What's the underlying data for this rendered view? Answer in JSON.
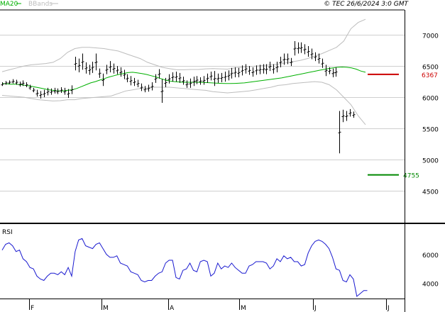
{
  "header": {
    "legend_ma": "MA20",
    "legend_bb": "BBands",
    "copyright": "© TEC 26/6/2024 3:0 GMT"
  },
  "colors": {
    "ma": "#00b000",
    "bands": "#bdbdbd",
    "price": "#000000",
    "rsi": "#1a1ad0",
    "resistance": "#cc0000",
    "support": "#008800",
    "grid": "#cfcfcf",
    "frame": "#000000"
  },
  "chart_data": [
    {
      "type": "ohlc",
      "title": "",
      "ylim": [
        4000,
        7400
      ],
      "y_ticks": [
        4500,
        5000,
        5500,
        6000,
        6500,
        7000
      ],
      "y_tick_labels": [
        "4500",
        "5000",
        "5500",
        "6000",
        "6500",
        "7000"
      ],
      "x_ticks": [
        "F",
        "M",
        "A",
        "M",
        "J",
        "J"
      ],
      "grid": true,
      "legend": "top-left",
      "bars_hl": [
        [
          6180,
          6240
        ],
        [
          6200,
          6260
        ],
        [
          6210,
          6270
        ],
        [
          6220,
          6290
        ],
        [
          6200,
          6280
        ],
        [
          6170,
          6250
        ],
        [
          6180,
          6270
        ],
        [
          6160,
          6240
        ],
        [
          6120,
          6200
        ],
        [
          6080,
          6150
        ],
        [
          6010,
          6120
        ],
        [
          5980,
          6100
        ],
        [
          6000,
          6120
        ],
        [
          6030,
          6150
        ],
        [
          6040,
          6140
        ],
        [
          6060,
          6150
        ],
        [
          6050,
          6140
        ],
        [
          6070,
          6160
        ],
        [
          6040,
          6150
        ],
        [
          5990,
          6130
        ],
        [
          6050,
          6190
        ],
        [
          6430,
          6650
        ],
        [
          6400,
          6620
        ],
        [
          6440,
          6700
        ],
        [
          6380,
          6560
        ],
        [
          6360,
          6520
        ],
        [
          6390,
          6570
        ],
        [
          6430,
          6700
        ],
        [
          6310,
          6460
        ],
        [
          6180,
          6380
        ],
        [
          6370,
          6520
        ],
        [
          6400,
          6580
        ],
        [
          6380,
          6540
        ],
        [
          6370,
          6500
        ],
        [
          6330,
          6480
        ],
        [
          6290,
          6440
        ],
        [
          6240,
          6370
        ],
        [
          6190,
          6340
        ],
        [
          6180,
          6310
        ],
        [
          6160,
          6280
        ],
        [
          6100,
          6220
        ],
        [
          6080,
          6180
        ],
        [
          6090,
          6200
        ],
        [
          6110,
          6240
        ],
        [
          6230,
          6370
        ],
        [
          6300,
          6450
        ],
        [
          5910,
          6290
        ],
        [
          6160,
          6310
        ],
        [
          6220,
          6370
        ],
        [
          6250,
          6400
        ],
        [
          6250,
          6410
        ],
        [
          6230,
          6390
        ],
        [
          6200,
          6330
        ],
        [
          6150,
          6270
        ],
        [
          6150,
          6300
        ],
        [
          6180,
          6330
        ],
        [
          6210,
          6340
        ],
        [
          6200,
          6320
        ],
        [
          6200,
          6340
        ],
        [
          6230,
          6380
        ],
        [
          6270,
          6410
        ],
        [
          6180,
          6420
        ],
        [
          6230,
          6380
        ],
        [
          6240,
          6390
        ],
        [
          6250,
          6410
        ],
        [
          6270,
          6430
        ],
        [
          6300,
          6470
        ],
        [
          6320,
          6480
        ],
        [
          6320,
          6470
        ],
        [
          6350,
          6510
        ],
        [
          6380,
          6530
        ],
        [
          6360,
          6500
        ],
        [
          6330,
          6480
        ],
        [
          6360,
          6510
        ],
        [
          6370,
          6520
        ],
        [
          6380,
          6530
        ],
        [
          6370,
          6530
        ],
        [
          6420,
          6570
        ],
        [
          6380,
          6530
        ],
        [
          6400,
          6570
        ],
        [
          6480,
          6650
        ],
        [
          6520,
          6700
        ],
        [
          6530,
          6700
        ],
        [
          6500,
          6630
        ],
        [
          6670,
          6900
        ],
        [
          6700,
          6880
        ],
        [
          6710,
          6880
        ],
        [
          6690,
          6850
        ],
        [
          6650,
          6820
        ],
        [
          6610,
          6780
        ],
        [
          6580,
          6720
        ],
        [
          6540,
          6700
        ],
        [
          6470,
          6620
        ],
        [
          6340,
          6520
        ],
        [
          6370,
          6480
        ],
        [
          6320,
          6460
        ],
        [
          6330,
          6480
        ],
        [
          5100,
          5780
        ],
        [
          5600,
          5800
        ],
        [
          5620,
          5780
        ],
        [
          5690,
          5810
        ],
        [
          5670,
          5770
        ]
      ],
      "ma20": [
        6220,
        6215,
        6210,
        6208,
        6200,
        6190,
        6180,
        6165,
        6150,
        6135,
        6120,
        6110,
        6100,
        6100,
        6110,
        6120,
        6140,
        6170,
        6200,
        6230,
        6250,
        6275,
        6300,
        6325,
        6345,
        6365,
        6380,
        6395,
        6400,
        6390,
        6380,
        6365,
        6345,
        6325,
        6300,
        6275,
        6260,
        6250,
        6245,
        6240,
        6240,
        6240,
        6240,
        6238,
        6235,
        6230,
        6225,
        6222,
        6220,
        6220,
        6222,
        6225,
        6230,
        6240,
        6250,
        6260,
        6270,
        6280,
        6290,
        6300,
        6310,
        6325,
        6340,
        6355,
        6370,
        6385,
        6400,
        6415,
        6430,
        6445,
        6460,
        6470,
        6480,
        6485,
        6480,
        6470,
        6450,
        6420,
        6400
      ],
      "bb_upper": [
        6410,
        6440,
        6470,
        6500,
        6520,
        6530,
        6540,
        6560,
        6620,
        6720,
        6780,
        6800,
        6800,
        6790,
        6780,
        6760,
        6740,
        6700,
        6660,
        6620,
        6560,
        6520,
        6480,
        6460,
        6440,
        6440,
        6445,
        6445,
        6455,
        6460,
        6455,
        6450,
        6470,
        6480,
        6490,
        6500,
        6510,
        6520,
        6530,
        6550,
        6570,
        6590,
        6620,
        6660,
        6700,
        6750,
        6800,
        6900,
        7100,
        7200,
        7250
      ],
      "bb_lower": [
        6030,
        6020,
        6010,
        6000,
        5980,
        5960,
        5950,
        5940,
        5945,
        5960,
        5960,
        5980,
        5990,
        6000,
        6010,
        6020,
        6060,
        6100,
        6120,
        6140,
        6150,
        6160,
        6160,
        6160,
        6150,
        6140,
        6130,
        6120,
        6110,
        6090,
        6080,
        6070,
        6080,
        6090,
        6100,
        6120,
        6140,
        6160,
        6190,
        6200,
        6220,
        6230,
        6240,
        6250,
        6240,
        6200,
        6120,
        6000,
        5880,
        5700,
        5560
      ],
      "resistance": {
        "value": 6367,
        "label": "6367"
      },
      "support": {
        "value": 4755,
        "label": "4755"
      }
    },
    {
      "type": "line",
      "title": "RSI",
      "ylim": [
        30,
        80
      ],
      "y_ticks": [
        40,
        60
      ],
      "y_tick_labels": [
        "4000",
        "6000"
      ],
      "series": [
        {
          "values": [
            63,
            67,
            68,
            66,
            62,
            63,
            57,
            55,
            51,
            50,
            45,
            43,
            42,
            45,
            47,
            47,
            46,
            48,
            46,
            51,
            45,
            62,
            70,
            71,
            66,
            65,
            64,
            67,
            68,
            64,
            60,
            58,
            58,
            59,
            54,
            53,
            52,
            48,
            47,
            46,
            42,
            41,
            42,
            42,
            45,
            47,
            48,
            54,
            56,
            56,
            44,
            43,
            49,
            50,
            54,
            49,
            48,
            55,
            56,
            55,
            45,
            47,
            54,
            50,
            52,
            51,
            54,
            51,
            49,
            47,
            47,
            52,
            53,
            55,
            55,
            55,
            54,
            50,
            52,
            57,
            55,
            59,
            57,
            58,
            55,
            55,
            52,
            53,
            61,
            66,
            69,
            70,
            69,
            67,
            64,
            58,
            50,
            49,
            42,
            41,
            46,
            43,
            31,
            33,
            35,
            35
          ]
        }
      ]
    }
  ]
}
